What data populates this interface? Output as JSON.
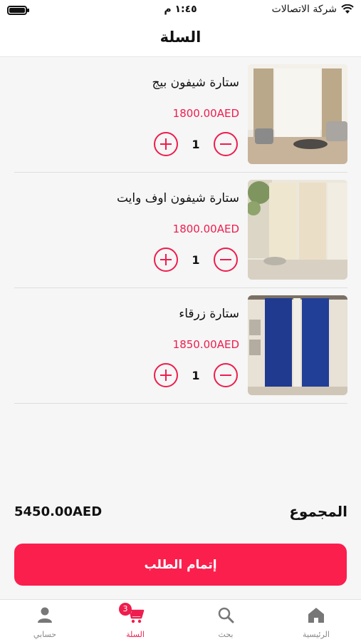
{
  "status_bar": {
    "carrier": "شركة الاتصالات",
    "time": "١:٤٥ م"
  },
  "header": {
    "title": "السلة"
  },
  "cart": {
    "items": [
      {
        "name": "ستارة شيفون بيج",
        "price": "1800.00AED",
        "quantity": "1"
      },
      {
        "name": "ستارة شيفون اوف وايت",
        "price": "1800.00AED",
        "quantity": "1"
      },
      {
        "name": "ستارة زرقاء",
        "price": "1850.00AED",
        "quantity": "1"
      }
    ],
    "total_label": "المجموع",
    "total_value": "5450.00AED",
    "checkout_label": "إتمام الطلب"
  },
  "tabbar": {
    "home": "الرئيسية",
    "search": "بحث",
    "cart": "السلة",
    "cart_badge": "3",
    "account": "حسابي"
  },
  "colors": {
    "accent": "#ee1d4d",
    "button": "#fb1f4d"
  }
}
